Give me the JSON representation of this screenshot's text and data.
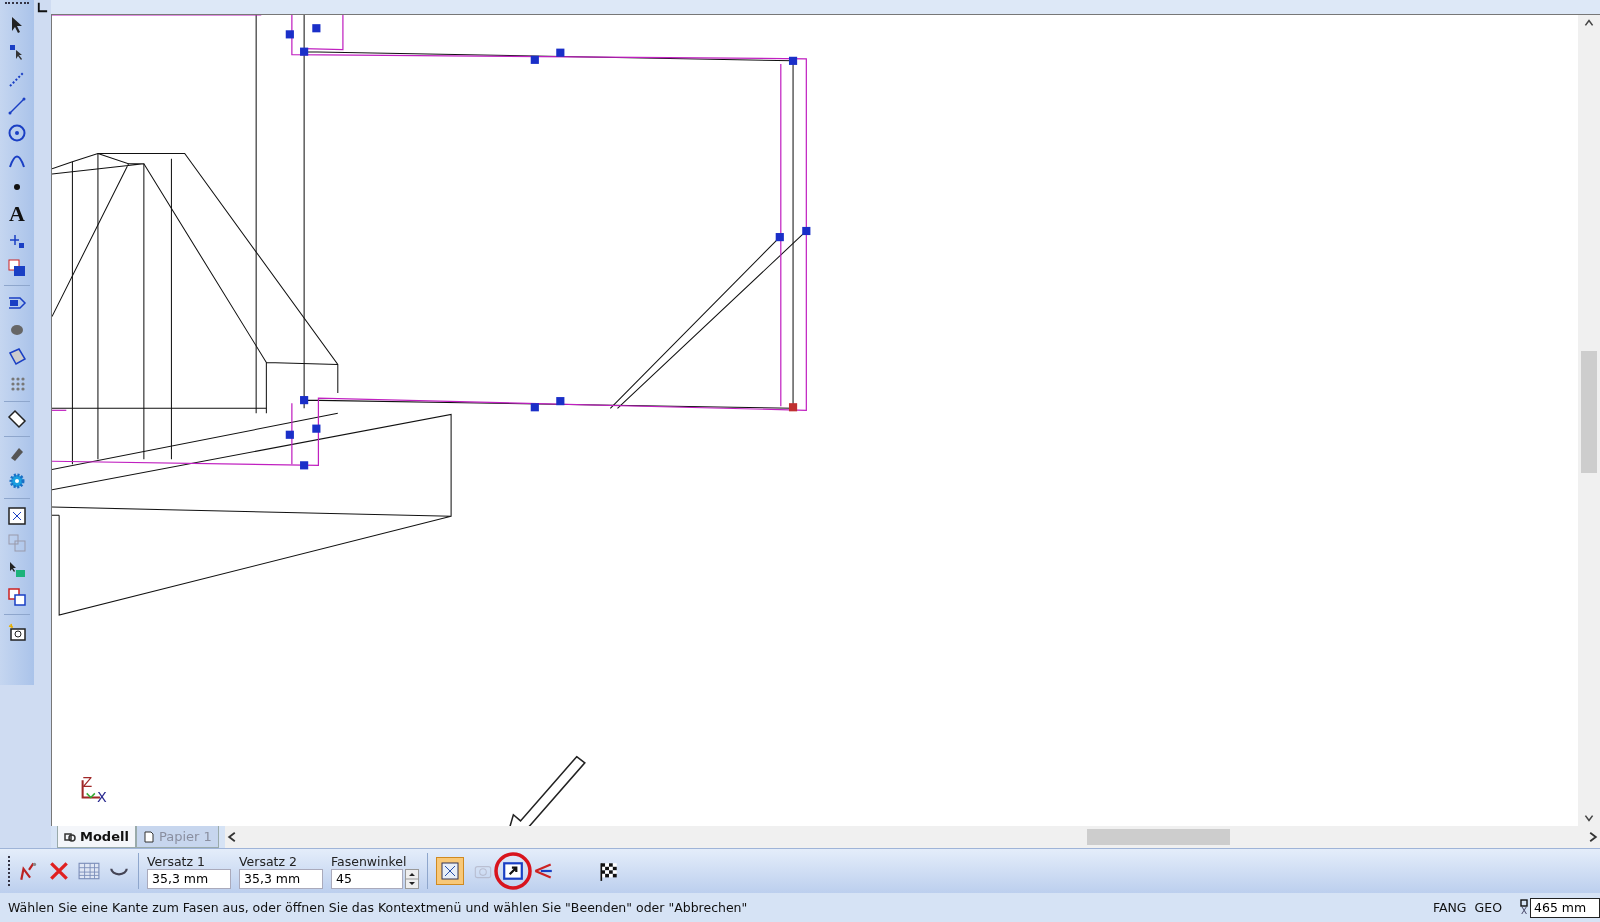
{
  "left_toolbar": {
    "text_tool_glyph": "A"
  },
  "viewport": {
    "axis_labels": [
      "Z",
      "X"
    ]
  },
  "tabs": [
    {
      "label": "Modell",
      "selected": true
    },
    {
      "label": "Papier 1",
      "selected": false
    }
  ],
  "chamfer_toolbar": {
    "fields": [
      {
        "label": "Versatz 1",
        "value": "35,3 mm",
        "kind": "text"
      },
      {
        "label": "Versatz 2",
        "value": "35,3 mm",
        "kind": "text"
      },
      {
        "label": "Fasenwinkel",
        "value": "45",
        "kind": "spinner"
      }
    ],
    "mode_toggle_on": true
  },
  "status_bar": {
    "message": "Wählen Sie eine Kante zum Fasen aus, oder öffnen Sie das Kontextmenü und wählen Sie \"Beenden\" oder \"Abbrechen\"",
    "indicators": [
      "FANG",
      "GEO"
    ],
    "coordinate_axis": "X",
    "coordinate_value": "465 mm"
  }
}
